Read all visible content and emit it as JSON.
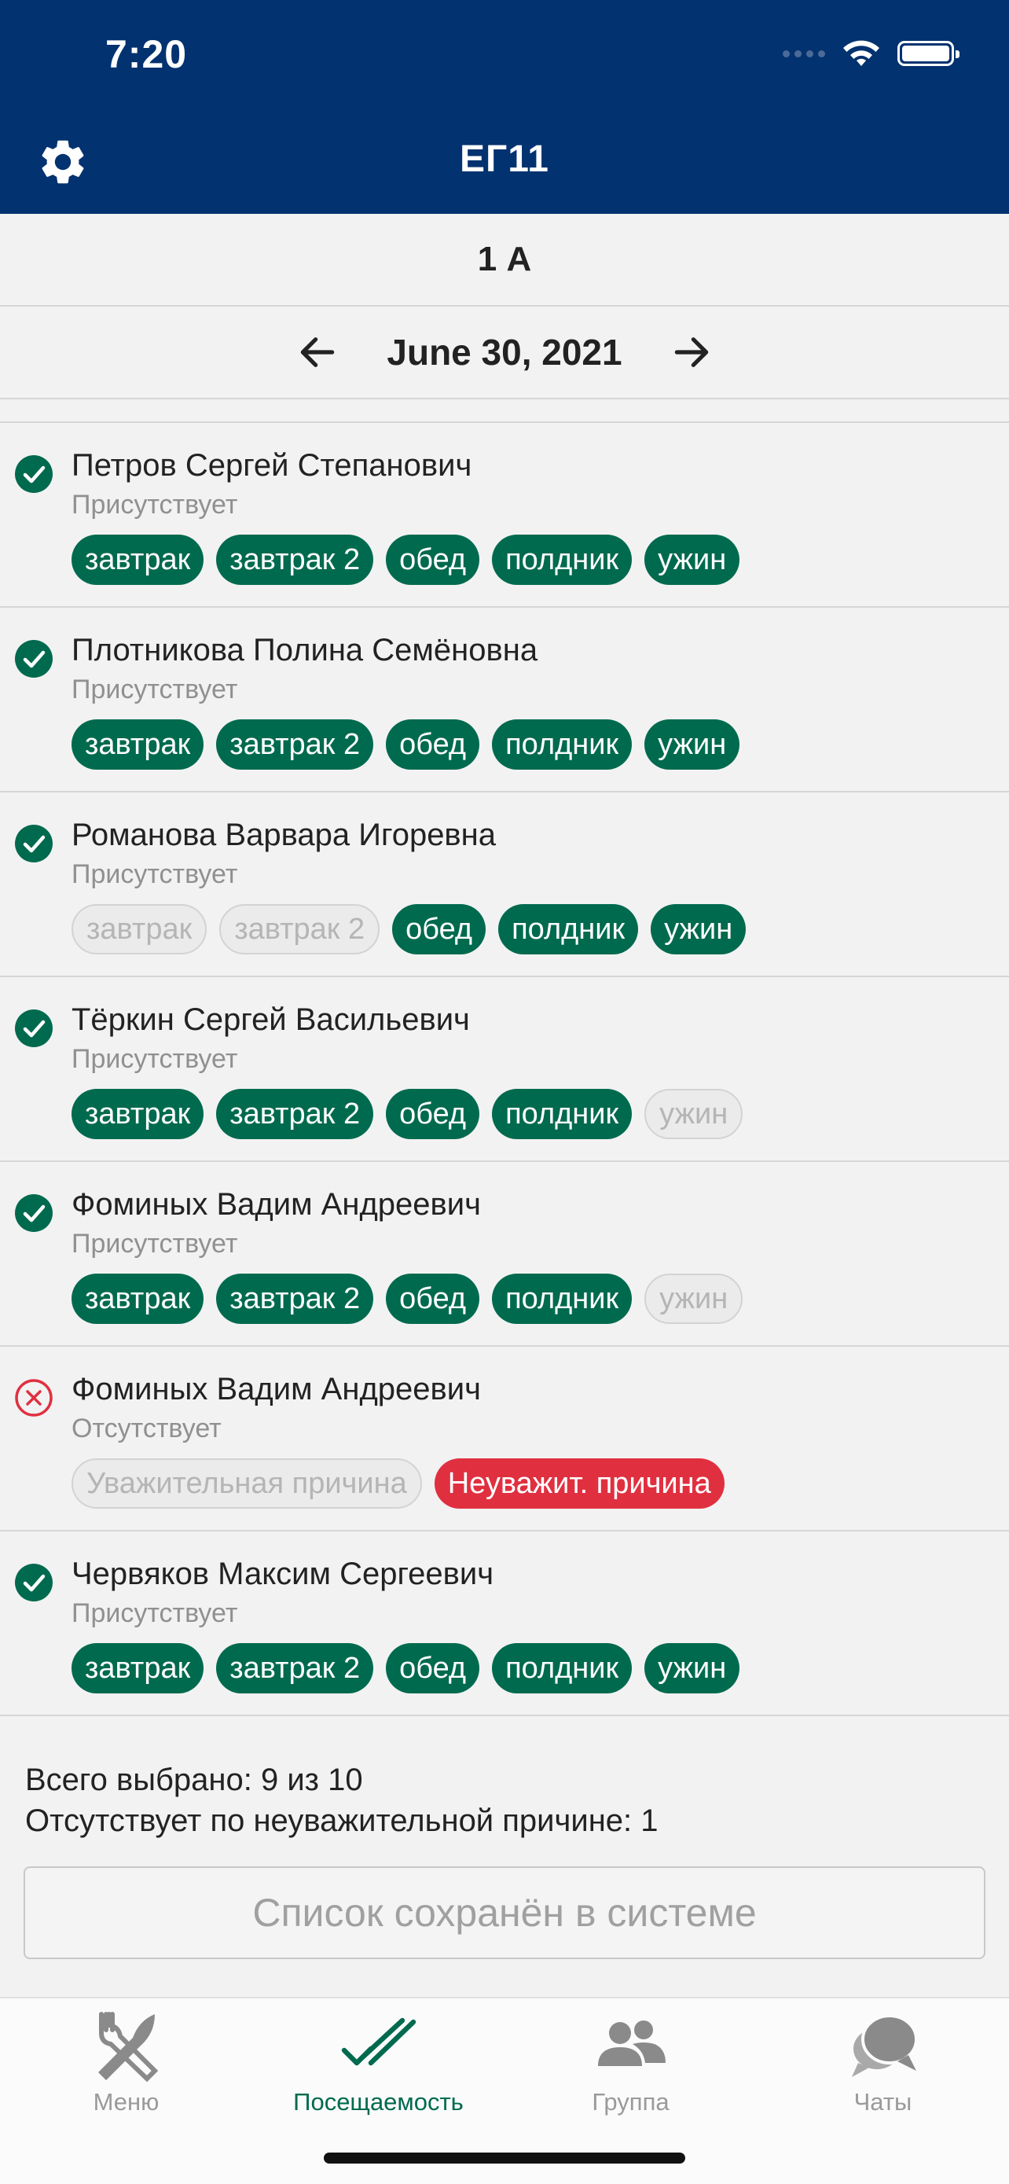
{
  "status_bar": {
    "time": "7:20"
  },
  "header": {
    "title": "ЕГ11"
  },
  "group": {
    "name": "1 А"
  },
  "date_nav": {
    "date": "June 30, 2021"
  },
  "colors": {
    "header_bg": "#02326f",
    "accent_green": "#006a4e",
    "absent_red": "#e03040"
  },
  "students": [
    {
      "name": "Петров Сергей Степанович",
      "status": "Присутствует",
      "present": true,
      "chips": [
        {
          "label": "завтрак",
          "on": true
        },
        {
          "label": "завтрак 2",
          "on": true
        },
        {
          "label": "обед",
          "on": true
        },
        {
          "label": "полдник",
          "on": true
        },
        {
          "label": "ужин",
          "on": true
        }
      ]
    },
    {
      "name": "Плотникова Полина Семёновна",
      "status": "Присутствует",
      "present": true,
      "chips": [
        {
          "label": "завтрак",
          "on": true
        },
        {
          "label": "завтрак 2",
          "on": true
        },
        {
          "label": "обед",
          "on": true
        },
        {
          "label": "полдник",
          "on": true
        },
        {
          "label": "ужин",
          "on": true
        }
      ]
    },
    {
      "name": "Романова Варвара Игоревна",
      "status": "Присутствует",
      "present": true,
      "chips": [
        {
          "label": "завтрак",
          "on": false
        },
        {
          "label": "завтрак 2",
          "on": false
        },
        {
          "label": "обед",
          "on": true
        },
        {
          "label": "полдник",
          "on": true
        },
        {
          "label": "ужин",
          "on": true
        }
      ]
    },
    {
      "name": "Тёркин Сергей Васильевич",
      "status": "Присутствует",
      "present": true,
      "chips": [
        {
          "label": "завтрак",
          "on": true
        },
        {
          "label": "завтрак 2",
          "on": true
        },
        {
          "label": "обед",
          "on": true
        },
        {
          "label": "полдник",
          "on": true
        },
        {
          "label": "ужин",
          "on": false
        }
      ]
    },
    {
      "name": "Фоминых  Вадим Андреевич",
      "status": "Присутствует",
      "present": true,
      "chips": [
        {
          "label": "завтрак",
          "on": true
        },
        {
          "label": "завтрак 2",
          "on": true
        },
        {
          "label": "обед",
          "on": true
        },
        {
          "label": "полдник",
          "on": true
        },
        {
          "label": "ужин",
          "on": false
        }
      ]
    },
    {
      "name": "Фоминых Вадим Андреевич",
      "status": "Отсутствует",
      "present": false,
      "chips": [
        {
          "label": "Уважительная причина",
          "on": false
        },
        {
          "label": "Неуважит. причина",
          "on": true,
          "red": true
        }
      ]
    },
    {
      "name": "Червяков Максим Сергеевич",
      "status": "Присутствует",
      "present": true,
      "chips": [
        {
          "label": "завтрак",
          "on": true
        },
        {
          "label": "завтрак 2",
          "on": true
        },
        {
          "label": "обед",
          "on": true
        },
        {
          "label": "полдник",
          "on": true
        },
        {
          "label": "ужин",
          "on": true
        }
      ]
    }
  ],
  "summary": {
    "selected": "Всего выбрано: 9 из 10",
    "absent_unexcused": "Отсутствует по неуважительной причине: 1"
  },
  "save_status": {
    "label": "Список сохранён в системе"
  },
  "tabs": [
    {
      "label": "Меню",
      "icon": "fork-knife-icon",
      "active": false
    },
    {
      "label": "Посещаемость",
      "icon": "double-check-icon",
      "active": true
    },
    {
      "label": "Группа",
      "icon": "people-icon",
      "active": false
    },
    {
      "label": "Чаты",
      "icon": "chat-bubbles-icon",
      "active": false
    }
  ]
}
